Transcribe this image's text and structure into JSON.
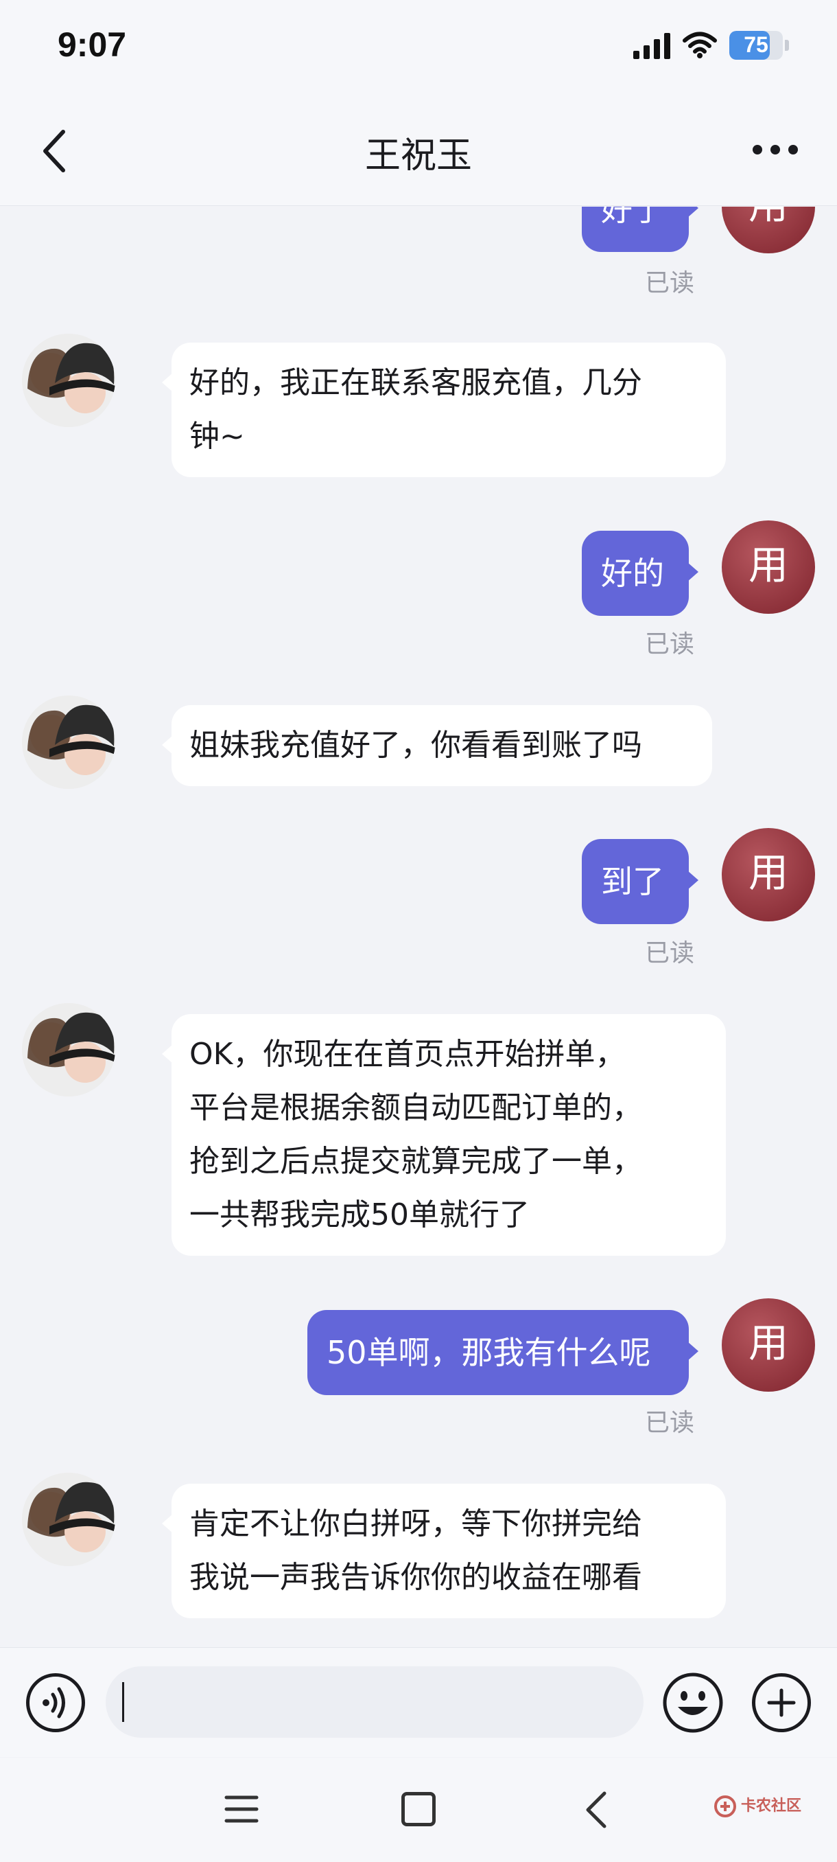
{
  "status_bar": {
    "time": "9:07",
    "battery": "75",
    "battery_level": 0.75
  },
  "header": {
    "title": "王祝玉",
    "back_icon": "chevron-left-icon",
    "more_icon": "more-horizontal-icon"
  },
  "self_avatar_label": "用",
  "messages": [
    {
      "from": "self",
      "text": "好了",
      "read": "已读"
    },
    {
      "from": "contact",
      "line1": "好的，我正在联系客服充值，几分",
      "line2": "钟~"
    },
    {
      "from": "self",
      "text": "好的",
      "read": "已读"
    },
    {
      "from": "contact",
      "line1": "姐妹我充值好了，你看看到账了吗"
    },
    {
      "from": "self",
      "text": "到了",
      "read": "已读"
    },
    {
      "from": "contact",
      "line1": "OK，你现在在首页点开始拼单，",
      "line2": "平台是根据余额自动匹配订单的，",
      "line3": "抢到之后点提交就算完成了一单，",
      "line4": "一共帮我完成50单就行了"
    },
    {
      "from": "self",
      "text": "50单啊，那我有什么呢",
      "read": "已读"
    },
    {
      "from": "contact",
      "line1": "肯定不让你白拼呀，等下你拼完给",
      "line2": "我说一声我告诉你你的收益在哪看"
    }
  ],
  "input_bar": {
    "voice_icon": "voice-icon",
    "emoji_icon": "emoji-icon",
    "add_icon": "plus-icon",
    "input_value": ""
  },
  "nav_bar": {
    "watermark": "卡农社区"
  },
  "colors": {
    "outgoing_bubble": "#6366d9",
    "incoming_bubble": "#ffffff",
    "self_avatar": "#9b3b44",
    "background": "#f2f3f7"
  }
}
